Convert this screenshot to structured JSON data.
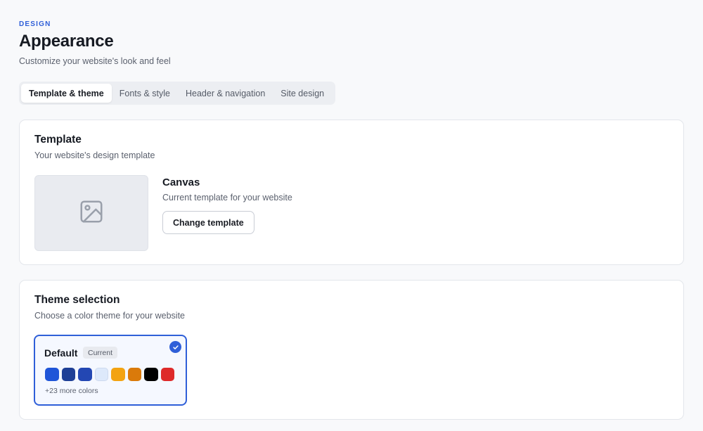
{
  "header": {
    "eyebrow": "DESIGN",
    "title": "Appearance",
    "subtitle": "Customize your website's look and feel"
  },
  "tabs": [
    {
      "label": "Template & theme",
      "active": true
    },
    {
      "label": "Fonts & style",
      "active": false
    },
    {
      "label": "Header & navigation",
      "active": false
    },
    {
      "label": "Site design",
      "active": false
    }
  ],
  "template_section": {
    "title": "Template",
    "subtitle": "Your website's design template",
    "thumbnail_icon": "image-placeholder-icon",
    "name": "Canvas",
    "description": "Current template for your website",
    "button_label": "Change template"
  },
  "theme_section": {
    "title": "Theme selection",
    "subtitle": "Choose a color theme for your website",
    "selected_theme": {
      "name": "Default",
      "badge": "Current",
      "selected_icon": "check-icon",
      "swatches": [
        "#1f55d8",
        "#1e3f96",
        "#2347b3",
        "#dde9fb",
        "#f3a311",
        "#da7a0a",
        "#000000",
        "#de2a2a"
      ],
      "more_label": "+23 more colors"
    }
  },
  "colors": {
    "accent": "#2f5fd8",
    "background": "#f8f9fb"
  }
}
